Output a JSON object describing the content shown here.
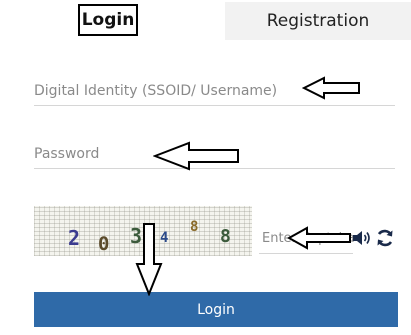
{
  "tabs": {
    "login_label": "Login",
    "registration_label": "Registration"
  },
  "form": {
    "username_placeholder": "Digital Identity (SSOID/ Username)",
    "password_placeholder": "Password",
    "captcha_placeholder": "Enter Captcha",
    "submit_label": "Login"
  },
  "captcha": {
    "characters": [
      "2",
      "0",
      "3",
      "4",
      "8",
      "8"
    ],
    "colors": [
      "#3b3b8f",
      "#5a4a2a",
      "#3b5a3b",
      "#2b4a8a",
      "#8a6a2a",
      "#3b5a3b"
    ]
  },
  "icons": {
    "audio": "speaker-icon",
    "refresh": "refresh-icon"
  },
  "colors": {
    "button": "#2f6aa8",
    "tab_inactive_bg": "#f2f2f2"
  }
}
